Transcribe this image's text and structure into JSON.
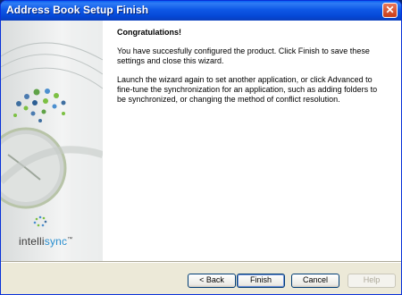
{
  "window": {
    "title": "Address Book Setup Finish"
  },
  "title_bar": {
    "close_glyph": "✕"
  },
  "sidebar": {
    "logo_prefix": "intelli",
    "logo_suffix": "sync",
    "logo_mark": "™"
  },
  "main": {
    "heading": "Congratulations!",
    "paragraph1": "You have succesfully configured the product. Click Finish to save these settings and close this wizard.",
    "paragraph2": "Launch the wizard again to set another application, or click Advanced to fine-tune the synchronization for an application, such as adding folders to be synchronized, or changing the method of conflict resolution."
  },
  "buttons": {
    "back": "< Back",
    "finish": "Finish",
    "cancel": "Cancel",
    "help": "Help"
  },
  "colors": {
    "titlebar": "#0a52e0",
    "close": "#d2512c",
    "logo_blue": "#2a8fcf",
    "dots_green": "#7cc043"
  }
}
